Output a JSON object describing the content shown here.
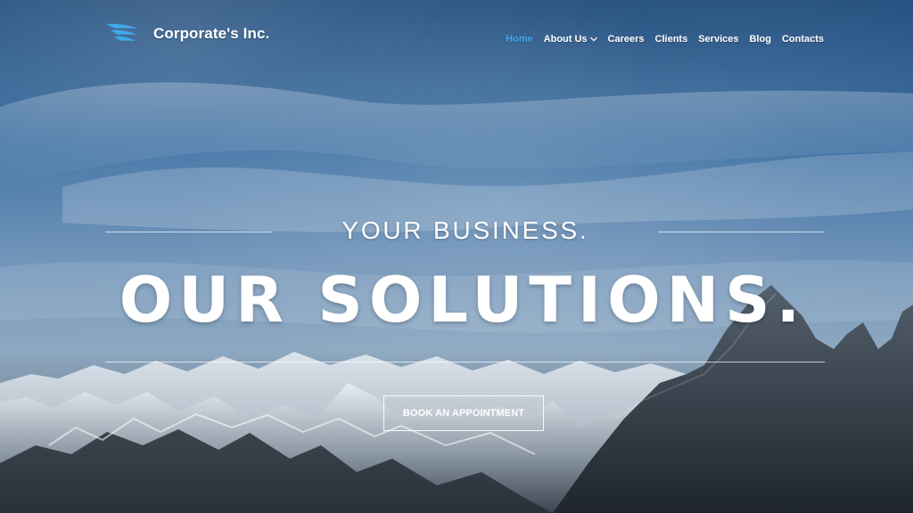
{
  "header": {
    "brand": "Corporate's Inc."
  },
  "nav": {
    "items": [
      {
        "label": "Home",
        "active": true
      },
      {
        "label": "About Us",
        "dropdown": true
      },
      {
        "label": "Careers"
      },
      {
        "label": "Clients"
      },
      {
        "label": "Services"
      },
      {
        "label": "Blog"
      },
      {
        "label": "Contacts"
      }
    ]
  },
  "hero": {
    "tagline": "YOUR BUSINESS.",
    "headline": "OUR SOLUTIONS.",
    "cta_label": "BOOK AN APPOINTMENT"
  },
  "colors": {
    "accent": "#3fa9e8",
    "text": "#ffffff"
  },
  "icons": {
    "logo": "wing-logo-icon",
    "dropdown": "chevron-down-icon"
  }
}
